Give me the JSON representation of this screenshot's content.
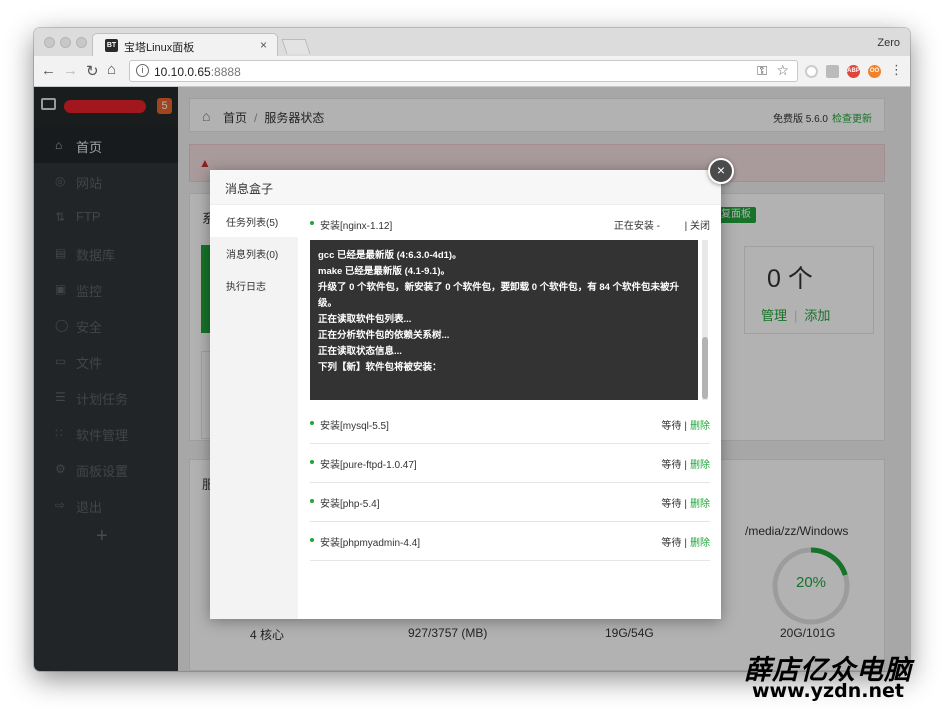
{
  "browser": {
    "tab_title": "宝塔Linux面板",
    "tab_favicon": "BT",
    "tab_close": "×",
    "profile_name": "Zero",
    "url_host": "10.10.0.65",
    "url_port": ":8888",
    "nav_icons": [
      "back-arrow-icon",
      "forward-arrow-icon",
      "reload-icon",
      "home-icon"
    ],
    "extensions": [
      "ext-circle-icon",
      "ext-screenshot-icon",
      "adblock-icon",
      "ext-infinity-icon"
    ]
  },
  "sidebar": {
    "badge": "5",
    "items": [
      {
        "label": "首页",
        "icon": "home-icon",
        "active": true
      },
      {
        "label": "网站",
        "icon": "globe-icon"
      },
      {
        "label": "FTP",
        "icon": "ftp-icon"
      },
      {
        "label": "数据库",
        "icon": "database-icon"
      },
      {
        "label": "监控",
        "icon": "monitor-icon"
      },
      {
        "label": "安全",
        "icon": "shield-icon"
      },
      {
        "label": "文件",
        "icon": "folder-icon"
      },
      {
        "label": "计划任务",
        "icon": "task-list-icon"
      },
      {
        "label": "软件管理",
        "icon": "apps-icon"
      },
      {
        "label": "面板设置",
        "icon": "gear-icon"
      },
      {
        "label": "退出",
        "icon": "logout-icon"
      }
    ],
    "add": "+"
  },
  "header": {
    "breadcrumb_home": "首页",
    "breadcrumb_sep": "/",
    "breadcrumb_current": "服务器状态",
    "version": "免费版 5.6.0",
    "check_update": "检查更新"
  },
  "dashboard": {
    "panel1_title_partial": "系",
    "fix_button": "修复面板",
    "db_count": "0 个",
    "db_manage": "管理",
    "db_sep": "|",
    "db_add": "添加",
    "panel2_title_partial": "服",
    "disk_path": "/media/zz/Windows",
    "disk_percent": "20%",
    "disk_percent_value": 20,
    "stats": [
      "4 核心",
      "927/3757 (MB)",
      "19G/54G",
      "20G/101G"
    ],
    "accent": "#20a53a"
  },
  "modal": {
    "title": "消息盒子",
    "close": "×",
    "nav": [
      {
        "label": "任务列表(5)",
        "active": true
      },
      {
        "label": "消息列表(0)"
      },
      {
        "label": "执行日志"
      }
    ],
    "current_task": {
      "name": "安装[nginx-1.12]",
      "status": "正在安装 -",
      "close": "| 关闭"
    },
    "log_lines": [
      "gcc 已经是最新版 (4:6.3.0-4d1)。",
      "make 已经是最新版 (4.1-9.1)。",
      "升级了 0 个软件包，新安装了 0 个软件包，要卸载 0 个软件包，有 84 个软件包未被升",
      "级。",
      "正在读取软件包列表...",
      "正在分析软件包的依赖关系树...",
      "正在读取状态信息...",
      "下列【新】软件包将被安装："
    ],
    "queue": [
      {
        "name": "安装[mysql-5.5]",
        "status": "等待",
        "sep": "|",
        "action": "删除"
      },
      {
        "name": "安装[pure-ftpd-1.0.47]",
        "status": "等待",
        "sep": "|",
        "action": "删除"
      },
      {
        "name": "安装[php-5.4]",
        "status": "等待",
        "sep": "|",
        "action": "删除"
      },
      {
        "name": "安装[phpmyadmin-4.4]",
        "status": "等待",
        "sep": "|",
        "action": "删除"
      }
    ]
  },
  "watermark": {
    "cn": "薛店亿众电脑",
    "url": "www.yzdn.net"
  }
}
